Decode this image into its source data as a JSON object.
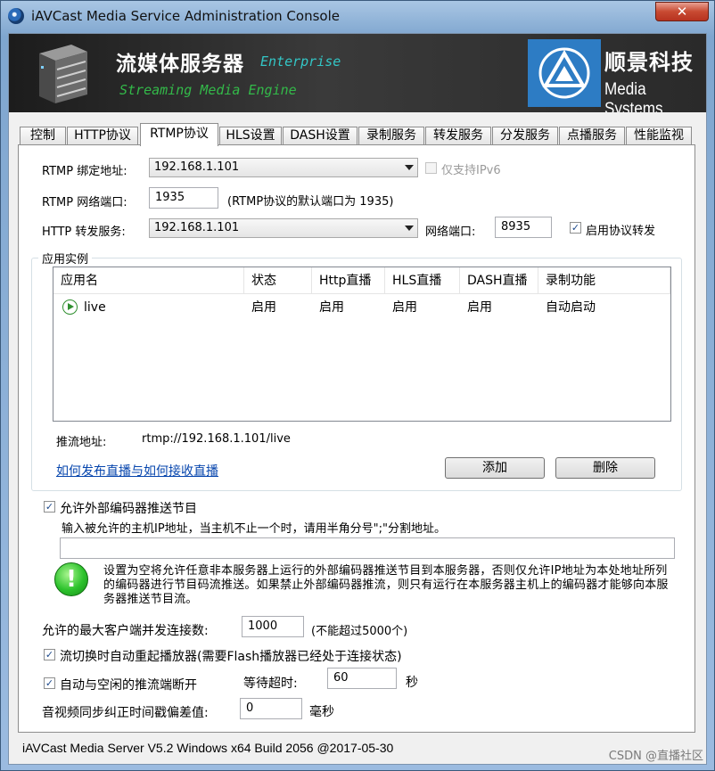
{
  "window": {
    "title": "iAVCast Media Service Administration Console",
    "close_label": "✕"
  },
  "banner": {
    "product_cn": "流媒体服务器",
    "edition": "Enterprise",
    "product_en": "Streaming Media Engine",
    "company_cn": "顺景科技",
    "company_en": "Media Systems"
  },
  "tabs": [
    {
      "label": "控制"
    },
    {
      "label": "HTTP协议"
    },
    {
      "label": "RTMP协议"
    },
    {
      "label": "HLS设置"
    },
    {
      "label": "DASH设置"
    },
    {
      "label": "录制服务"
    },
    {
      "label": "转发服务"
    },
    {
      "label": "分发服务"
    },
    {
      "label": "点播服务"
    },
    {
      "label": "性能监视"
    }
  ],
  "rtmp": {
    "bind_label": "RTMP 绑定地址:",
    "bind_value": "192.168.1.101",
    "ipv6_label": "仅支持IPv6",
    "port_label": "RTMP 网络端口:",
    "port_value": "1935",
    "port_hint": "(RTMP协议的默认端口为 1935)",
    "http_fwd_label": "HTTP 转发服务:",
    "http_fwd_value": "192.168.1.101",
    "net_port_label": "网络端口:",
    "net_port_value": "8935",
    "enable_fwd_label": "启用协议转发"
  },
  "instances": {
    "group_title": "应用实例",
    "columns": [
      "应用名",
      "状态",
      "Http直播",
      "HLS直播",
      "DASH直播",
      "录制功能"
    ],
    "rows": [
      {
        "name": "live",
        "status": "启用",
        "http": "启用",
        "hls": "启用",
        "dash": "启用",
        "record": "自动启动"
      }
    ],
    "push_label": "推流地址:",
    "push_value": "rtmp://192.168.1.101/live",
    "help_link": "如何发布直播与如何接收直播",
    "add_label": "添加",
    "delete_label": "删除"
  },
  "encoder": {
    "allow_label": "允许外部编码器推送节目",
    "hint": "输入被允许的主机IP地址，当主机不止一个时，请用半角分号\";\"分割地址。",
    "ip_value": "",
    "info_text": "设置为空将允许任意非本服务器上运行的外部编码器推送节目到本服务器，否则仅允许IP地址为本处地址所列的编码器进行节目码流推送。如果禁止外部编码器推流，则只有运行在本服务器主机上的编码器才能够向本服务器推送节目流。"
  },
  "options": {
    "max_clients_label": "允许的最大客户端并发连接数:",
    "max_clients_value": "1000",
    "max_clients_hint": "(不能超过5000个)",
    "auto_restart_label": "流切换时自动重起播放器(需要Flash播放器已经处于连接状态)",
    "auto_disconnect_label": "自动与空闲的推流端断开",
    "timeout_label": "等待超时:",
    "timeout_value": "60",
    "timeout_unit": "秒",
    "av_sync_label": "音视频同步纠正时间戳偏差值:",
    "av_sync_value": "0",
    "av_sync_unit": "毫秒"
  },
  "footer": {
    "version": "iAVCast Media Server V5.2 Windows x64 Build 2056 @2017-05-30",
    "watermark": "CSDN @直播社区"
  }
}
